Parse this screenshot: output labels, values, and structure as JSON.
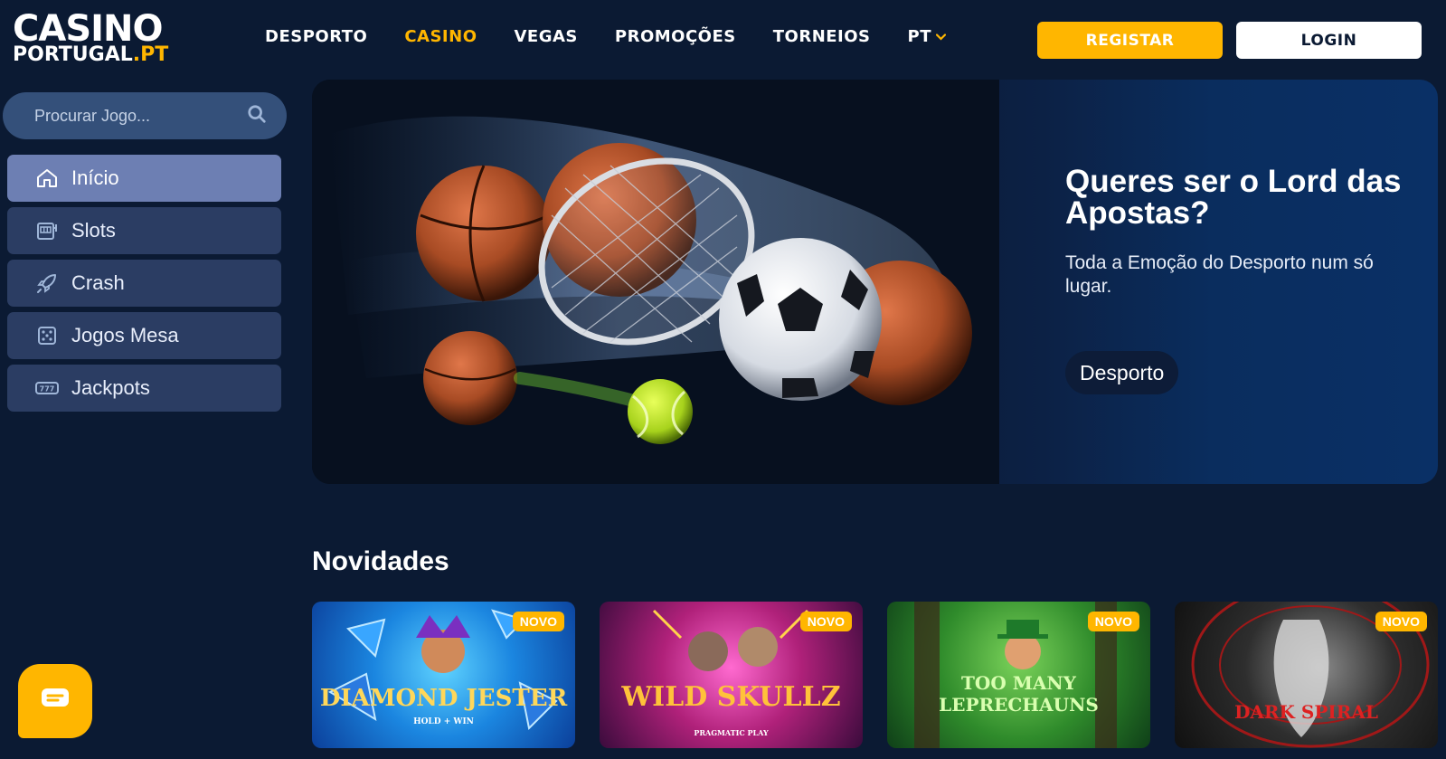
{
  "logo": {
    "line1": "CASINO",
    "line2": "PORTUGAL",
    "tld": ".PT"
  },
  "nav": {
    "items": [
      {
        "label": "DESPORTO",
        "active": false
      },
      {
        "label": "CASINO",
        "active": true
      },
      {
        "label": "VEGAS",
        "active": false
      },
      {
        "label": "PROMOÇÕES",
        "active": false
      },
      {
        "label": "TORNEIOS",
        "active": false
      }
    ],
    "language": "PT"
  },
  "auth": {
    "register_label": "REGISTAR",
    "login_label": "LOGIN"
  },
  "search": {
    "placeholder": "Procurar Jogo..."
  },
  "sidebar": {
    "items": [
      {
        "label": "Início",
        "icon": "home-icon",
        "active": true
      },
      {
        "label": "Slots",
        "icon": "slot-machine-icon",
        "active": false
      },
      {
        "label": "Crash",
        "icon": "rocket-icon",
        "active": false
      },
      {
        "label": "Jogos Mesa",
        "icon": "dice-icon",
        "active": false
      },
      {
        "label": "Jackpots",
        "icon": "jackpot-icon",
        "active": false
      }
    ]
  },
  "hero": {
    "title": "Queres ser o Lord das Apostas?",
    "subtitle": "Toda a Emoção do Desporto num só lugar.",
    "button_label": "Desporto"
  },
  "novidades": {
    "title": "Novidades",
    "badge": "NOVO",
    "games": [
      {
        "title": "DIAMOND JESTER",
        "tagline": "HOLD + WIN"
      },
      {
        "title": "WILD SKULLZ",
        "tagline": "PRAGMATIC PLAY"
      },
      {
        "title": "TOO MANY LEPRECHAUNS",
        "tagline": ""
      },
      {
        "title": "DARK SPIRAL",
        "tagline": ""
      }
    ]
  },
  "colors": {
    "accent": "#ffb600",
    "background": "#0b1a33",
    "sidebar_item": "#2b3d63",
    "sidebar_active": "#6d7fb3"
  }
}
